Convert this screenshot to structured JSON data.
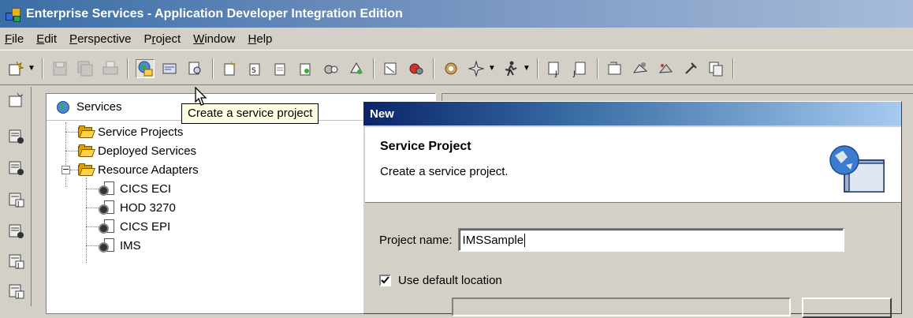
{
  "window": {
    "title": "Enterprise Services - Application Developer Integration Edition"
  },
  "menu": {
    "items": [
      "File",
      "Edit",
      "Perspective",
      "Project",
      "Window",
      "Help"
    ]
  },
  "services_view": {
    "title": "Services",
    "tree": [
      {
        "label": "Service Projects",
        "type": "folder"
      },
      {
        "label": "Deployed Services",
        "type": "folder"
      },
      {
        "label": "Resource Adapters",
        "type": "folder",
        "expanded": true
      },
      {
        "label": "CICS ECI",
        "type": "adapter"
      },
      {
        "label": "HOD 3270",
        "type": "adapter"
      },
      {
        "label": "CICS EPI",
        "type": "adapter"
      },
      {
        "label": "IMS",
        "type": "adapter"
      }
    ],
    "expander_symbol": "−"
  },
  "tooltip": {
    "text": "Create a service project"
  },
  "dialog": {
    "title": "New",
    "header_title": "Service Project",
    "header_description": "Create a service project.",
    "project_name_label": "Project name:",
    "project_name_value": "IMSSample",
    "use_default_location_label": "Use default location",
    "use_default_location_checked": true
  },
  "colors": {
    "title_bar_start": "#3a6ea5",
    "dialog_title_start": "#0a246a",
    "tooltip_bg": "#ffffe1",
    "window_bg": "#d4d0c8"
  },
  "icons": {
    "toolbar": [
      "new-wizard-icon",
      "save-icon",
      "save-all-icon",
      "print-icon",
      "create-service-project-icon",
      "open-service-icon",
      "search-icon",
      "new-service-icon",
      "new-service-alt-icon",
      "new-bridge-icon",
      "new-component-icon",
      "new-mapping-icon",
      "new-deployment-icon",
      "new-proxy-icon",
      "build-icon",
      "debug-icon",
      "run-icon",
      "java-file-icon",
      "java-file-alt-icon",
      "open-type-icon",
      "open-perspective-icon",
      "open-view-icon",
      "pin-icon",
      "copy-icon"
    ]
  }
}
